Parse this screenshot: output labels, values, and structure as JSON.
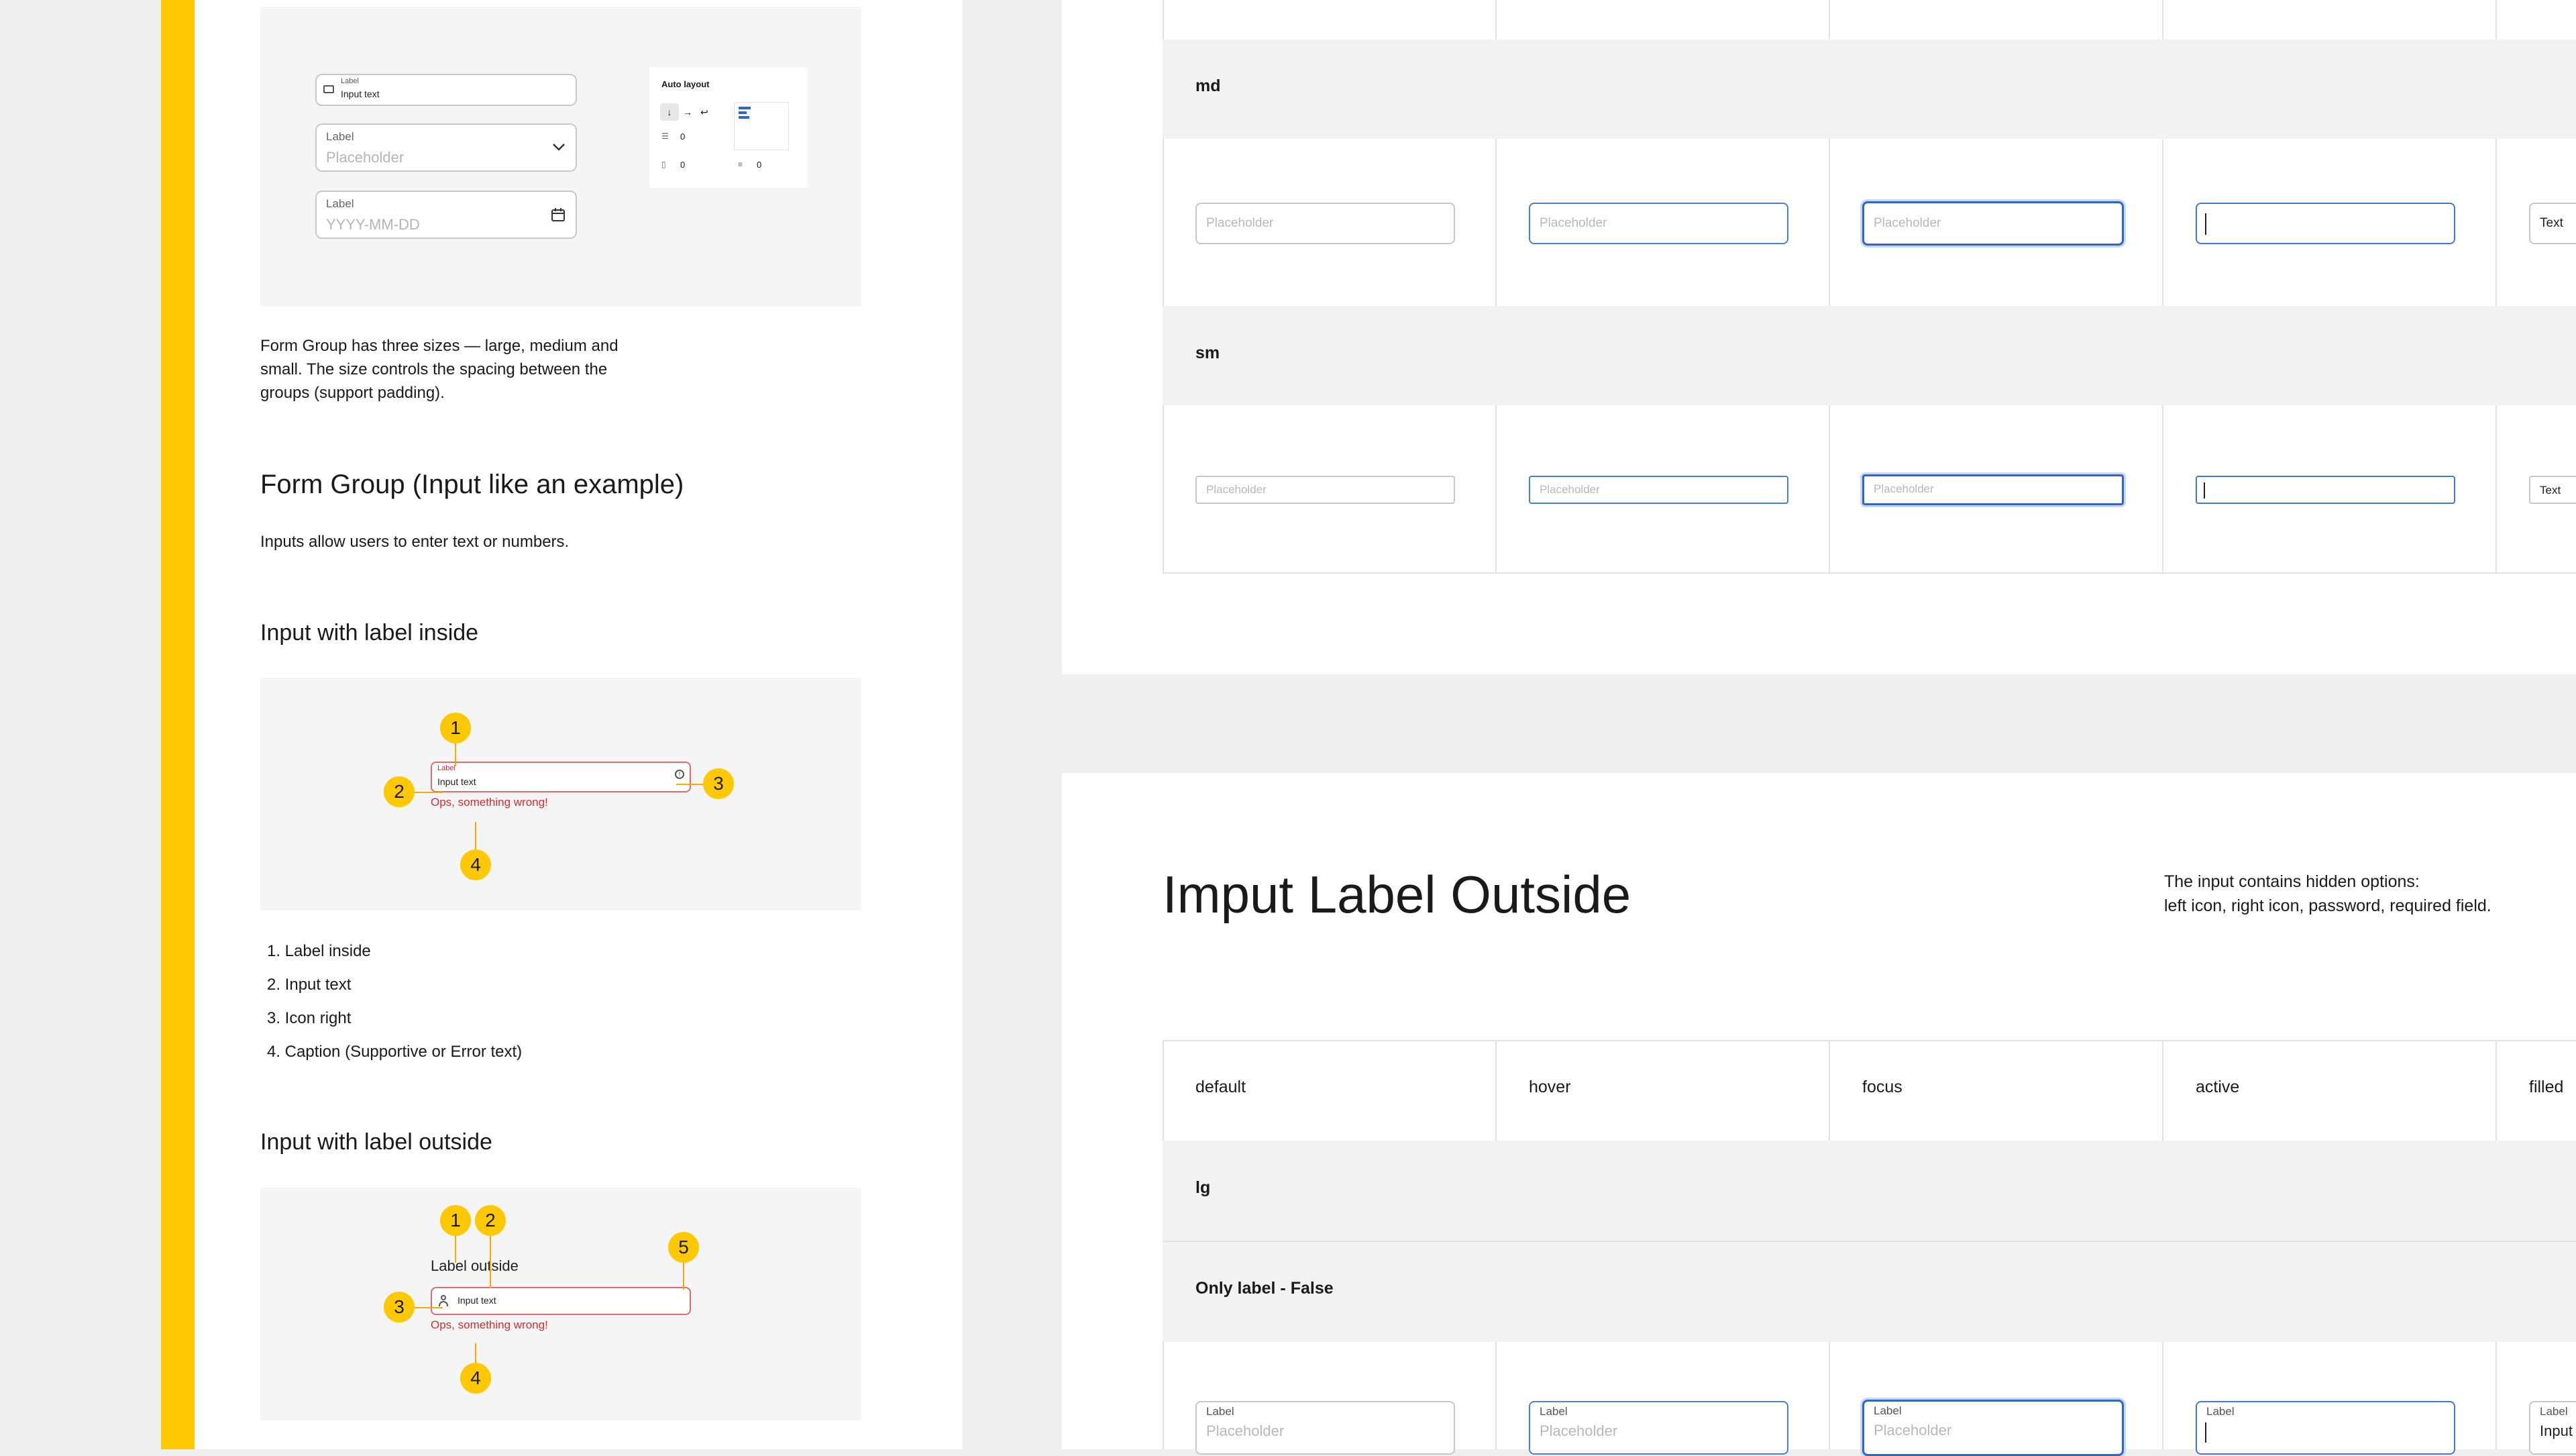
{
  "doc": {
    "frame1": {
      "input1_label": "Label",
      "input1_value": "Input text",
      "select_label": "Label",
      "select_placeholder": "Placeholder",
      "date_label": "Label",
      "date_placeholder": "YYYY-MM-DD",
      "auto_layout_title": "Auto layout",
      "auto_gap_1": "0",
      "auto_gap_2": "0",
      "auto_gap_3": "0"
    },
    "sizes_text_1": "Form Group has three sizes — large, medium and",
    "sizes_text_2": "small. The size controls the spacing between the",
    "sizes_text_3": "groups (support padding).",
    "form_group_title": "Form Group (Input like an example)",
    "form_group_desc": "Inputs allow users to enter text or numbers.",
    "inside_title": "Input with label inside",
    "inside_example": {
      "label": "Label",
      "value": "Input text",
      "error": "Ops, something wrong!",
      "markers": [
        "1",
        "2",
        "3",
        "4"
      ]
    },
    "inside_list": [
      "1.  Label inside",
      "2.  Input text",
      "3.  Icon right",
      "4.  Caption (Supportive or Error text)"
    ],
    "outside_title": "Input with label outside",
    "outside_example": {
      "label": "Label outside",
      "value": "Input text",
      "error": "Ops, something wrong!",
      "markers": [
        "1",
        "2",
        "3",
        "4",
        "5"
      ]
    }
  },
  "canvas": {
    "top_rows": {
      "md": "md",
      "sm": "sm"
    },
    "placeholder": "Placeholder",
    "filled_text": "Text",
    "section_title": "Imput Label Outside",
    "section_note_1": "The input contains hidden options:",
    "section_note_2": "left icon, right icon, password, required field.",
    "columns": [
      "default",
      "hover",
      "focus",
      "active",
      "filled"
    ],
    "row_lg": "lg",
    "row_only_label": "Only label - False",
    "field_label": "Label",
    "field_input_partial": "Input"
  }
}
